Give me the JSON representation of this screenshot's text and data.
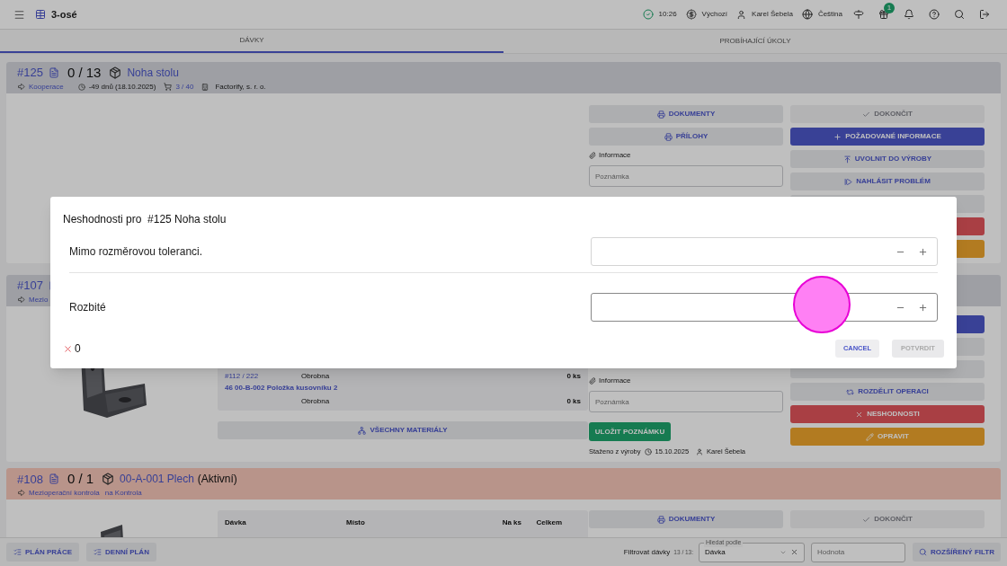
{
  "topbar": {
    "title": "3-osé",
    "time": "10:26",
    "profile": "Výchozí",
    "user": "Karel Šebela",
    "language": "Čeština",
    "gift_badge": "1"
  },
  "tabs": [
    {
      "label": "DÁVKY",
      "selected": true
    },
    {
      "label": "PROBÍHAJÍCÍ ÚKOLY",
      "selected": false
    }
  ],
  "batches": [
    {
      "number": "#125",
      "count": "0 / 13",
      "name": "Noha stolu",
      "highlighted": false,
      "operation": "Kooperace",
      "deadline": "-49 dnů (18.10.2025)",
      "cart": "3 / 40",
      "supplier": "Factorify, s. r. o.",
      "actions_a": [
        {
          "kind": "print",
          "label": "DOKUMENTY",
          "disabled": false
        },
        {
          "kind": "print",
          "label": "PŘÍLOHY",
          "disabled": false
        }
      ],
      "info_label": "Informace",
      "note_placeholder": "Poznámka",
      "actions_b": [
        {
          "kind": "finish",
          "label": "DOKONČIT",
          "disabled": true
        },
        {
          "kind": "request",
          "label": "POŽADOVANÉ INFORMACE",
          "disabled": false
        },
        {
          "kind": "release",
          "label": "UVOLNIT DO VÝROBY",
          "disabled": false
        },
        {
          "kind": "report",
          "label": "NAHLÁSIT PROBLÉM",
          "disabled": false
        },
        {
          "kind": "plain"
        },
        {
          "kind": "danger"
        },
        {
          "kind": "warning"
        }
      ]
    },
    {
      "number": "#107",
      "highlighted": false,
      "operation": "Mezio",
      "thumbnail": true,
      "materials": {
        "rows": [
          {
            "cells": [
              "#112 / 222",
              "Obrobna",
              "0 ks"
            ]
          },
          {
            "title": "46 00-B-002 Položka kusovníku 2"
          },
          {
            "cells": [
              "",
              "Obrobna",
              "0 ks"
            ]
          }
        ],
        "all_button": "VŠECHNY MATERIÁLY"
      },
      "info_label": "Informace",
      "note_placeholder": "Poznámka",
      "save_note": "ULOŽIT POZNÁMKU",
      "downloaded": {
        "label": "Staženo z výroby",
        "date": "15.10.2025",
        "user": "Karel Šebela"
      },
      "actions_b": [
        {
          "kind": "primary"
        },
        {
          "kind": "plain"
        },
        {
          "kind": "plain"
        },
        {
          "kind": "split",
          "label": "ROZDĚLIT OPERACI",
          "disabled": false
        },
        {
          "kind": "defects",
          "label": "NESHODNOSTI",
          "disabled": false
        },
        {
          "kind": "repair",
          "label": "OPRAVIT",
          "disabled": false
        }
      ]
    },
    {
      "number": "#108",
      "count": "0 / 1",
      "name": "00-A-001 Plech",
      "state": "(Aktivní)",
      "highlighted": true,
      "operation": "Mezioperační kontrola",
      "place": "na Kontrola",
      "thumbnail": true,
      "materials": {
        "columns": [
          "Dávka",
          "Místo",
          "Na ks",
          "Celkem"
        ]
      },
      "actions_a": [
        {
          "kind": "print",
          "label": "DOKUMENTY",
          "disabled": false
        }
      ],
      "actions_b": [
        {
          "kind": "finish",
          "label": "DOKONČIT",
          "disabled": true
        }
      ]
    }
  ],
  "bottom_bar": {
    "buttons": [
      "PLÁN PRÁCE",
      "DENNÍ PLÁN"
    ],
    "filter_label": "Filtrovat dávky",
    "filter_count": "13 / 13:",
    "search_by": {
      "label": "Hledat podle",
      "value": "Dávka"
    },
    "value_field": {
      "placeholder": "Hodnota"
    },
    "advanced_filter": "ROZŠÍŘENÝ FILTR"
  },
  "dialog": {
    "title": "Neshodnosti pro  #125 Noha stolu",
    "rows": [
      {
        "label": "Mimo rozměrovou toleranci.",
        "focused": false
      },
      {
        "label": "Rozbité",
        "focused": true
      }
    ],
    "total": "0",
    "cancel": "CANCEL",
    "confirm": "POTVRDIT",
    "confirm_disabled": true
  }
}
